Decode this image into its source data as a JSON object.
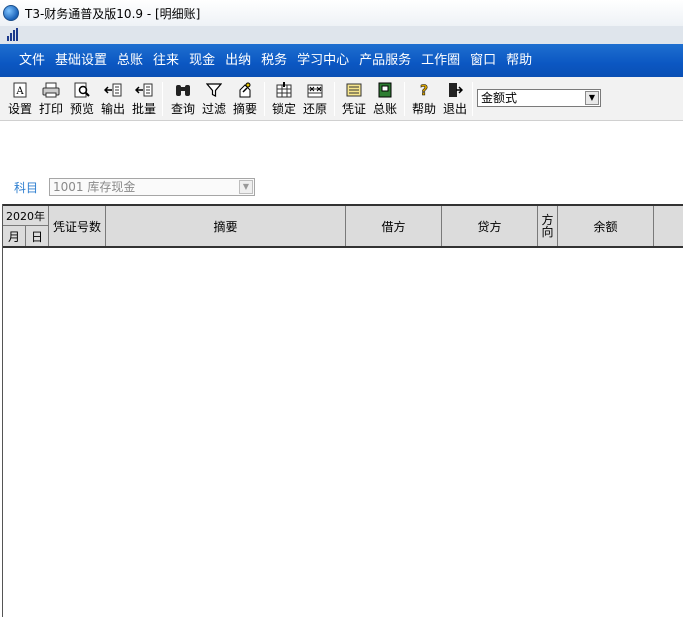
{
  "window": {
    "title": "T3-财务通普及版10.9 - [明细账]"
  },
  "menu": [
    "文件",
    "基础设置",
    "总账",
    "往来",
    "现金",
    "出纳",
    "税务",
    "学习中心",
    "产品服务",
    "工作圈",
    "窗口",
    "帮助"
  ],
  "toolbar": {
    "buttons": [
      {
        "label": "设置",
        "icon": "settings-doc-icon"
      },
      {
        "label": "打印",
        "icon": "printer-icon"
      },
      {
        "label": "预览",
        "icon": "preview-icon"
      },
      {
        "label": "输出",
        "icon": "export-icon"
      },
      {
        "label": "批量",
        "icon": "batch-icon"
      },
      {
        "label": "查询",
        "icon": "binoculars-icon"
      },
      {
        "label": "过滤",
        "icon": "filter-icon"
      },
      {
        "label": "摘要",
        "icon": "summary-icon"
      },
      {
        "label": "锁定",
        "icon": "lock-column-icon"
      },
      {
        "label": "还原",
        "icon": "restore-icon"
      },
      {
        "label": "凭证",
        "icon": "voucher-icon"
      },
      {
        "label": "总账",
        "icon": "ledger-book-icon"
      },
      {
        "label": "帮助",
        "icon": "help-icon"
      },
      {
        "label": "退出",
        "icon": "exit-icon"
      }
    ],
    "format_select": "金额式"
  },
  "subject": {
    "label": "科目",
    "value": "1001  库存现金"
  },
  "grid": {
    "year": "2020年",
    "month": "月",
    "day": "日",
    "voucher_no": "凭证号数",
    "summary": "摘要",
    "debit": "借方",
    "credit": "贷方",
    "direction_1": "方",
    "direction_2": "向",
    "balance": "余额"
  }
}
